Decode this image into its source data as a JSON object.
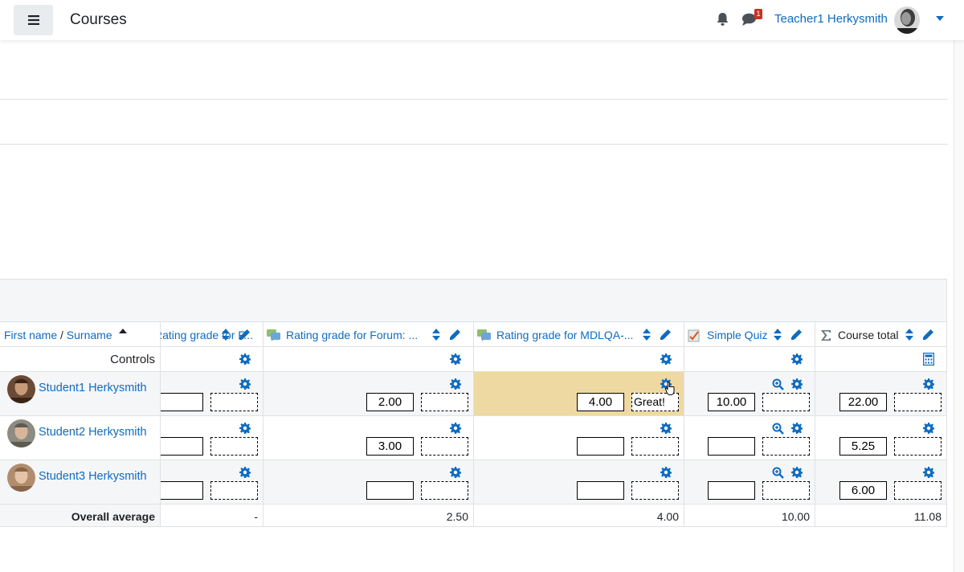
{
  "header": {
    "menu_icon": "hamburger-icon",
    "title": "Courses",
    "notification_icon": "bell-icon",
    "messages_icon": "chat-icon",
    "messages_badge": "1",
    "user_name": "Teacher1 Herkysmith"
  },
  "grader": {
    "columns": {
      "name": {
        "first": "First name",
        "separator": " / ",
        "surname": "Surname"
      },
      "col1": {
        "title": "Rating grade for F..."
      },
      "col2": {
        "title": "Rating grade for Forum: ..."
      },
      "col3": {
        "title": "Rating grade for MDLQA-..."
      },
      "col4": {
        "title": "Simple Quiz"
      },
      "col5": {
        "title": "Course total"
      }
    },
    "controls_label": "Controls",
    "students": [
      {
        "name": "Student1 Herkysmith",
        "grades": [
          "",
          "2.00",
          "4.00",
          "10.00",
          "22.00"
        ],
        "feedback": [
          "",
          "",
          "Great!",
          "",
          ""
        ]
      },
      {
        "name": "Student2 Herkysmith",
        "grades": [
          "",
          "3.00",
          "",
          "",
          "5.25"
        ],
        "feedback": [
          "",
          "",
          "",
          "",
          ""
        ]
      },
      {
        "name": "Student3 Herkysmith",
        "grades": [
          "",
          "",
          "",
          "",
          "6.00"
        ],
        "feedback": [
          "",
          "",
          "",
          "",
          ""
        ]
      }
    ],
    "overall": {
      "label": "Overall average",
      "values": [
        "-",
        "2.50",
        "4.00",
        "10.00",
        "11.08"
      ]
    },
    "colors": {
      "link": "#0f6cbf",
      "highlight": "#efd9a3"
    }
  }
}
